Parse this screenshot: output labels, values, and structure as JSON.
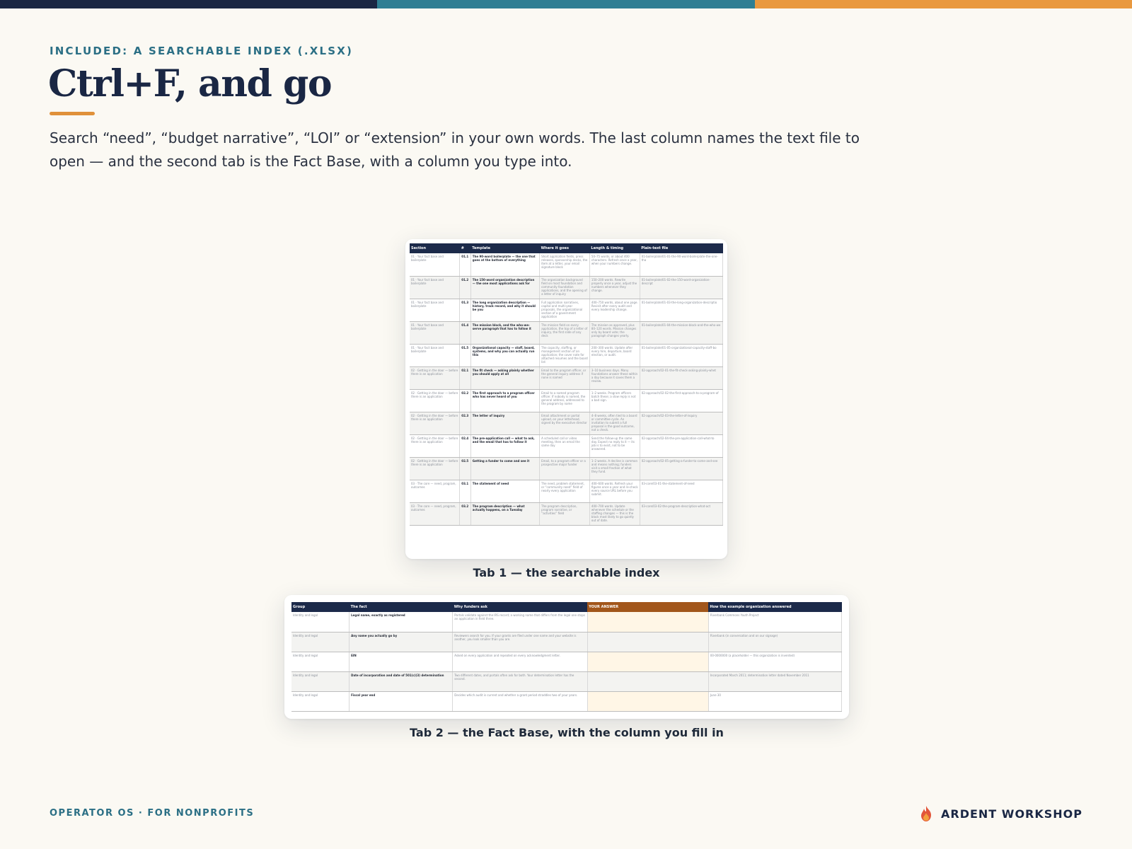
{
  "eyebrow": "INCLUDED: A SEARCHABLE INDEX (.XLSX)",
  "title": "Ctrl+F, and go",
  "lede": "Search “need”, “budget narrative”, “LOI” or “extension” in your own words. The last column names the text file to open — and the second tab is the Fact Base, with a column you type into.",
  "index_table": {
    "headers": [
      "Section",
      "#",
      "Template",
      "Where it goes",
      "Length & timing",
      "Plain-text file"
    ],
    "rows": [
      [
        "01 · Your fact base and boilerplate",
        "01.1",
        "The 90-word boilerplate — the one that goes at the bottom of everything",
        "Short application fields, press releases, sponsorship decks, the item at a letter, your email signature block",
        "50–75 words, or about 400 characters. Refresh once a year, when your numbers change.",
        "01-boilerplate/01-01-the-90-word-boilerplate-the-one-tha"
      ],
      [
        "01 · Your fact base and boilerplate",
        "01.2",
        "The 150-word organization description — the one most applications ask for",
        "The organization background field on most foundation and community foundation applications, and the opening of a letter of inquiry",
        "150–200 words. Rewrite properly once a year, adjust the numbers whenever they change.",
        "01-boilerplate/01-02-the-150-word-organization-descript"
      ],
      [
        "01 · Your fact base and boilerplate",
        "01.3",
        "The long organization description — history, track record, and why it should be you",
        "Full application narratives, capital and multi-year proposals, the organizational section of a government application",
        "400–750 words, about one page. Revisit after every audit and every leadership change.",
        "01-boilerplate/01-03-the-long-organization-descriptio"
      ],
      [
        "01 · Your fact base and boilerplate",
        "01.4",
        "The mission block, and the who-we-serve paragraph that has to follow it",
        "The mission field on every application, the top of a letter of inquiry, the first slide of any deck",
        "The mission as approved, plus 80–120 words. Mission changes only by board vote; the paragraph changes yearly.",
        "01-boilerplate/01-04-the-mission-block-and-the-who-we"
      ],
      [
        "01 · Your fact base and boilerplate",
        "01.5",
        "Organizational capacity — staff, board, systems, and why you can actually run this",
        "The capacity, staffing, or management section of an application; the cover note for attached resumes and the board list",
        "200–300 words. Update after every hire, departure, board election, or audit.",
        "01-boilerplate/01-05-organizational-capacity-staff-bo"
      ],
      [
        "02 · Getting in the door — before there is an application",
        "02.1",
        "The fit check — asking plainly whether you should apply at all",
        "Email to the program officer, or the general inquiry address if none is named",
        "3–10 business days. Many foundations answer these within a day because it saves them a review.",
        "02-approach/02-01-the-fit-check-asking-plainly-whet"
      ],
      [
        "02 · Getting in the door — before there is an application",
        "02.2",
        "The first approach to a program officer who has never heard of you",
        "Email to a named program officer. If nobody is named, the general address, addressed to the program by name",
        "1–2 weeks. Program officers batch these; a slow reply is not a bad sign.",
        "02-approach/02-02-the-first-approach-to-a-program-of"
      ],
      [
        "02 · Getting in the door — before there is an application",
        "02.3",
        "The letter of inquiry",
        "Email attachment or portal upload, on your letterhead, signed by the executive director",
        "4–8 weeks, often tied to a board or committee cycle. An invitation to submit a full proposal is the good outcome, not a check.",
        "02-approach/02-03-the-letter-of-inquiry"
      ],
      [
        "02 · Getting in the door — before there is an application",
        "02.4",
        "The pre-application call — what to ask, and the email that has to follow it",
        "A scheduled call or video meeting, then an email the same day",
        "Send the follow-up the same day. Expect no reply to it — its job is to exist, not to be answered.",
        "02-approach/02-04-the-pre-application-call-what-to"
      ],
      [
        "02 · Getting in the door — before there is an application",
        "02.5",
        "Getting a funder to come and see it",
        "Email, to a program officer or a prospective major funder",
        "1–2 weeks. A decline is common and means nothing; funders visit a small fraction of what they fund.",
        "02-approach/02-05-getting-a-funder-to-come-and-see"
      ],
      [
        "03 · The core — need, program, outcomes",
        "03.1",
        "The statement of need",
        "The need, problem statement, or “community need” field of nearly every application",
        "400–600 words. Refresh your figures once a year and re-check every source URL before you submit.",
        "03-core/03-01-the-statement-of-need"
      ],
      [
        "03 · The core — need, program, outcomes",
        "03.2",
        "The program description — what actually happens, on a Tuesday",
        "The program description, program narrative, or “activities” field",
        "400–700 words. Update whenever the schedule or the staffing changes — this is the block most likely to go quietly out of date.",
        "03-core/03-02-the-program-description-what-act"
      ]
    ]
  },
  "factbase_table": {
    "headers": [
      "Group",
      "The fact",
      "Why funders ask",
      "YOUR ANSWER",
      "How the example organization answered"
    ],
    "rows": [
      [
        "Identity and legal",
        "Legal name, exactly as registered",
        "Portals validate against the IRS record; a working name that differs from the legal one stops an application in field three.",
        "",
        "Riverbank Commons Youth Project"
      ],
      [
        "Identity and legal",
        "Any name you actually go by",
        "Reviewers search for you. If your grants are filed under one name and your website is another, you look smaller than you are.",
        "",
        "Riverbank (in conversation and on our signage)"
      ],
      [
        "Identity and legal",
        "EIN",
        "Asked on every application and repeated on every acknowledgment letter.",
        "",
        "00-0000000 (a placeholder — this organization is invented)"
      ],
      [
        "Identity and legal",
        "Date of incorporation and date of 501(c)(3) determination",
        "Two different dates, and portals often ask for both. Your determination letter has the second.",
        "",
        "Incorporated March 2011; determination letter dated November 2011"
      ],
      [
        "Identity and legal",
        "Fiscal year end",
        "Decides which audit is current and whether a grant period straddles two of your years.",
        "",
        "June 30"
      ]
    ]
  },
  "caption1": "Tab 1 — the searchable index",
  "caption2": "Tab 2 — the Fact Base, with the column you fill in",
  "footer_left": "OPERATOR OS · FOR NONPROFITS",
  "brand": "ARDENT WORKSHOP",
  "colors": {
    "navy": "#1a2744",
    "teal": "#2e7f93",
    "orange": "#e9993f",
    "background": "#fbf9f3",
    "answer_header": "#a2561b",
    "answer_fill": "#fff6e6"
  },
  "icons": {
    "brand_mark": "flame-icon"
  }
}
